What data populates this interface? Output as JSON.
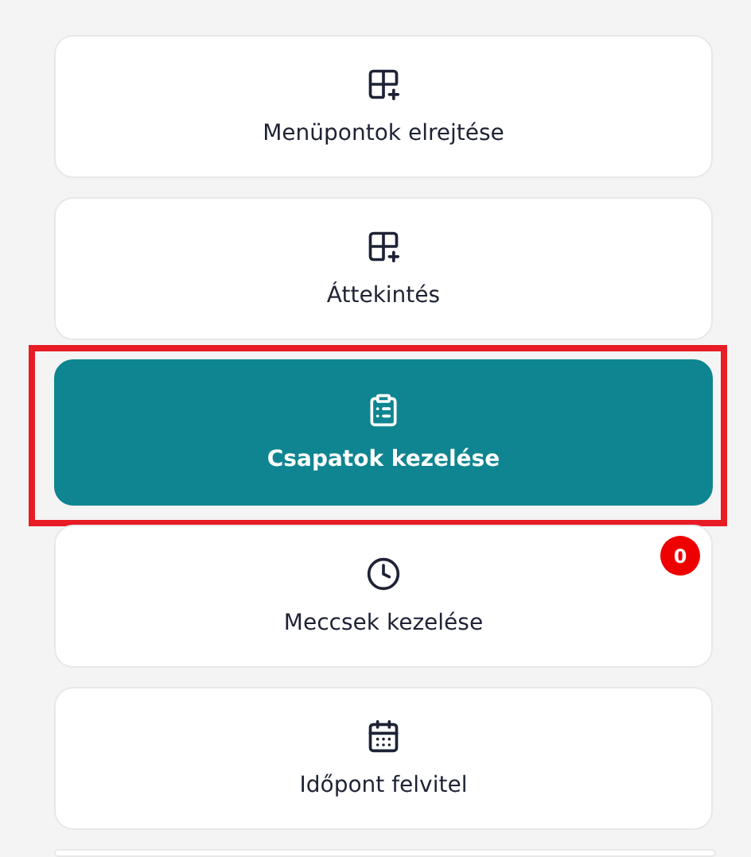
{
  "menu_items": [
    {
      "label": "Menüpontok elrejtése",
      "selected": false,
      "highlighted": false
    },
    {
      "label": "Áttekintés",
      "selected": false,
      "highlighted": false
    },
    {
      "label": "Csapatok kezelése",
      "selected": true,
      "highlighted": true
    },
    {
      "label": "Meccsek kezelése",
      "selected": false,
      "highlighted": false,
      "badge": "0"
    },
    {
      "label": "Időpont felvitel",
      "selected": false,
      "highlighted": false
    }
  ]
}
